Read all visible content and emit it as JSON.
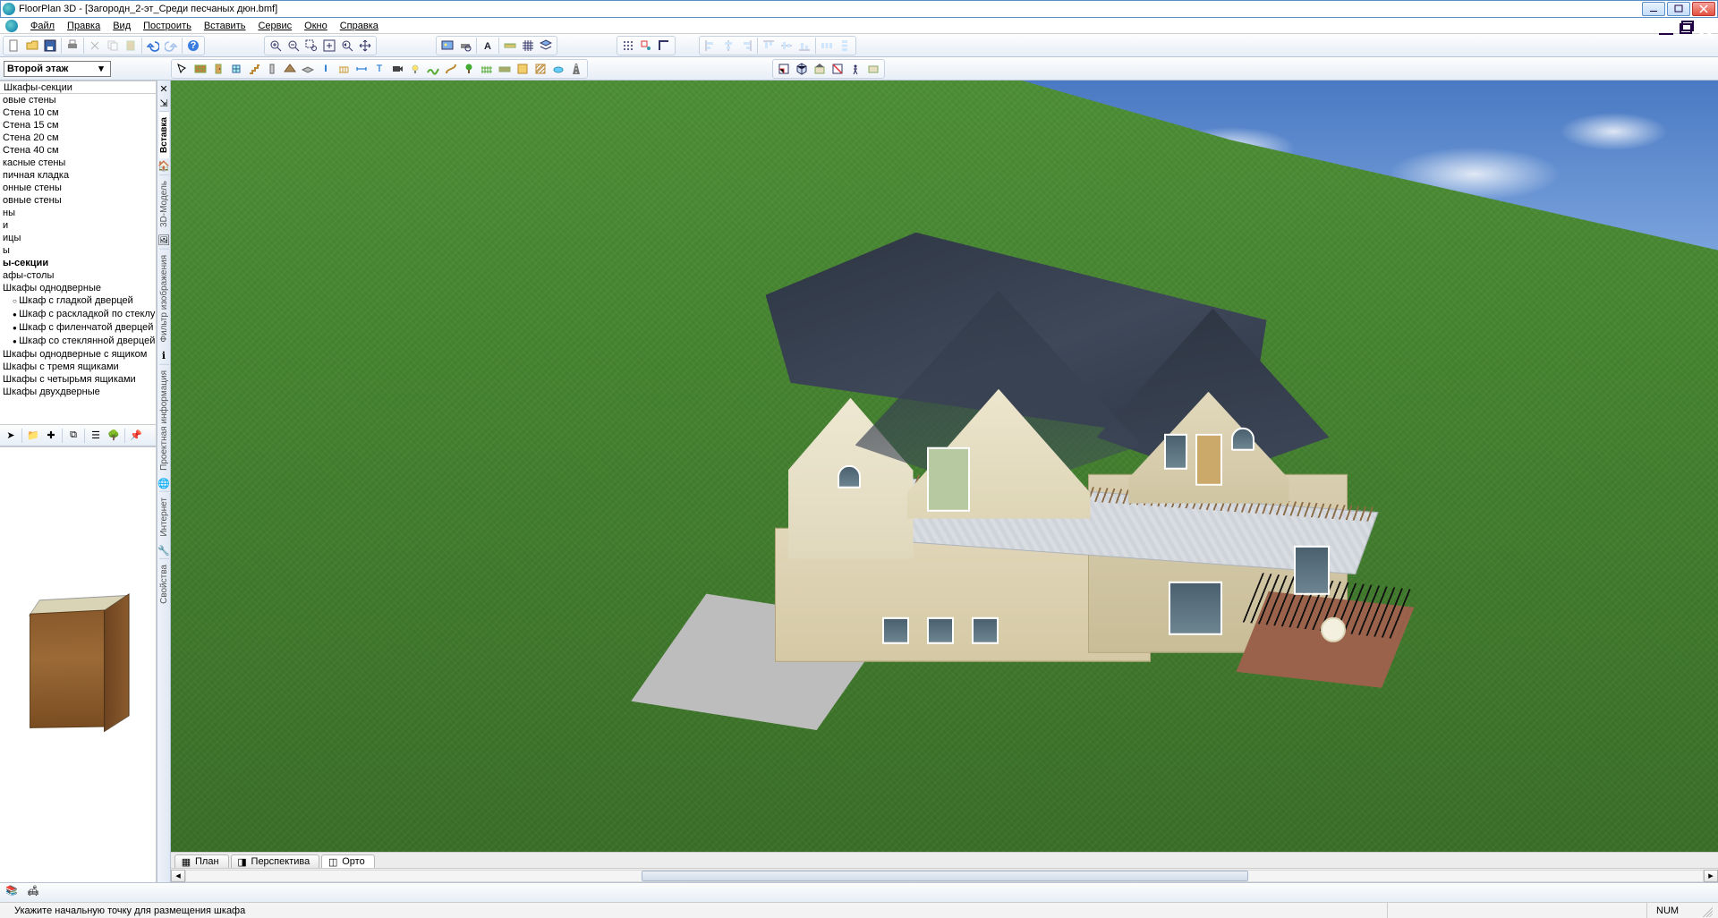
{
  "app": {
    "title": "FloorPlan 3D - [Загородн_2-эт_Среди песчаных дюн.bmf]"
  },
  "menu": {
    "file": "Файл",
    "edit": "Правка",
    "view": "Вид",
    "build": "Построить",
    "insert": "Вставить",
    "service": "Сервис",
    "window": "Окно",
    "help": "Справка"
  },
  "floor": {
    "selected": "Второй этаж"
  },
  "panel": {
    "title": "Шкафы-секции"
  },
  "tree": {
    "items": [
      {
        "t": "овые стены"
      },
      {
        "t": "Стена 10 см"
      },
      {
        "t": "Стена 15 см"
      },
      {
        "t": "Стена 20 см"
      },
      {
        "t": "Стена 40 см"
      },
      {
        "t": "касные стены"
      },
      {
        "t": "пичная кладка"
      },
      {
        "t": "онные стены"
      },
      {
        "t": "овные стены"
      },
      {
        "t": "ны"
      },
      {
        "t": "и"
      },
      {
        "t": "ицы"
      },
      {
        "t": "ы"
      },
      {
        "t": "ы-секции",
        "bold": true
      },
      {
        "t": "афы-столы"
      },
      {
        "t": "Шкафы однодверные"
      },
      {
        "t": "Шкаф с гладкой дверцей",
        "sub": "o"
      },
      {
        "t": "Шкаф с раскладкой по стеклу",
        "sub": "b"
      },
      {
        "t": "Шкаф с филенчатой дверцей",
        "sub": "b"
      },
      {
        "t": "Шкаф со стеклянной дверцей",
        "sub": "b"
      },
      {
        "t": "Шкафы однодверные с ящиком"
      },
      {
        "t": "Шкафы с тремя ящиками"
      },
      {
        "t": "Шкафы с четырьмя ящиками"
      },
      {
        "t": "Шкафы двухдверные"
      }
    ]
  },
  "vtabs": {
    "insert": "Вставка",
    "model": "3D-Модель",
    "imgfilter": "Фильтр изображения",
    "projinfo": "Проектная информация",
    "internet": "Интернет",
    "props": "Свойства"
  },
  "viewtabs": {
    "plan": "План",
    "perspective": "Перспектива",
    "ortho": "Орто"
  },
  "status": {
    "msg": "Укажите начальную точку для размещения шкафа",
    "num": "NUM"
  },
  "icons": {
    "new": "new",
    "open": "open",
    "save": "save",
    "print": "print",
    "cut": "cut",
    "copy": "copy",
    "paste": "paste",
    "undo": "undo",
    "redo": "redo",
    "help": "help",
    "zoomin": "zoom-in",
    "zoomout": "zoom-out",
    "zoomwin": "zoom-window",
    "zoomfit": "zoom-fit",
    "zoomprev": "zoom-previous",
    "pan": "pan",
    "render": "render",
    "printview": "print-preview",
    "text": "text",
    "measure": "measure",
    "grid": "grid",
    "layers": "layers",
    "snapgrid": "snap-grid",
    "snapobj": "snap-object",
    "ortho": "ortho-toggle",
    "alignl": "align-left",
    "alignc": "align-center",
    "alignr": "align-right",
    "alignt": "align-top",
    "alignm": "align-middle",
    "alignb": "align-bottom",
    "disth": "distribute-h",
    "distv": "distribute-v",
    "select": "select",
    "wall": "wall",
    "door": "door",
    "window": "window",
    "stairs": "stairs",
    "column": "column",
    "beam": "beam",
    "roof": "roof",
    "slab": "slab",
    "rail": "railing",
    "terrain": "terrain",
    "plant": "plant",
    "path": "path",
    "light": "light",
    "camera": "camera",
    "dim": "dimension",
    "text2": "text-label",
    "area": "area",
    "hatch": "hatch",
    "fence": "fence",
    "deck": "deck",
    "pool": "pool",
    "road": "road",
    "view3d": "view-3d",
    "viewplan": "view-plan",
    "viewelev": "view-elevation",
    "viewsec": "view-section",
    "viewortho": "view-ortho",
    "viewfly": "view-walkthrough"
  }
}
